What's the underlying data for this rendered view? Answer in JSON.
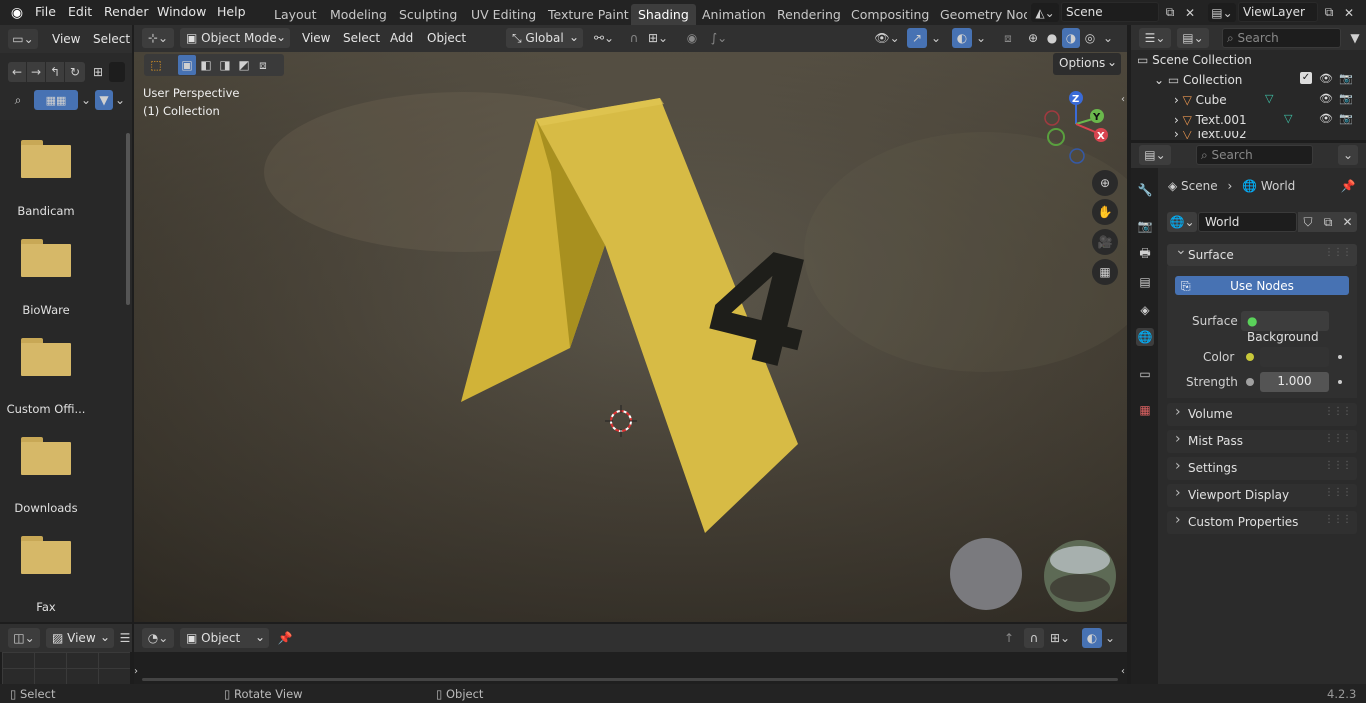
{
  "menu": [
    "File",
    "Edit",
    "Render",
    "Window",
    "Help"
  ],
  "workspaces": [
    "Layout",
    "Modeling",
    "Sculpting",
    "UV Editing",
    "Texture Paint",
    "Shading",
    "Animation",
    "Rendering",
    "Compositing",
    "Geometry Node"
  ],
  "active_workspace": "Shading",
  "scene_name": "Scene",
  "view_layer": "ViewLayer",
  "file_browser": {
    "header": [
      "View",
      "Select"
    ],
    "folders": [
      "Bandicam",
      "BioWare",
      "Custom Offi...",
      "Downloads",
      "Fax"
    ]
  },
  "viewport": {
    "mode": "Object Mode",
    "menus": [
      "View",
      "Select",
      "Add",
      "Object"
    ],
    "transform": "Global",
    "options_label": "Options",
    "overlay_text1": "User Perspective",
    "overlay_text2": "(1) Collection",
    "marker_number": "4",
    "gizmo": {
      "x": "X",
      "y": "Y",
      "z": "Z"
    }
  },
  "shader_editor": {
    "mode": "Object"
  },
  "outliner": {
    "search_placeholder": "Search",
    "root": "Scene Collection",
    "collection": "Collection",
    "items": [
      "Cube",
      "Text.001",
      "Text.002"
    ]
  },
  "properties": {
    "search_placeholder": "Search",
    "breadcrumb": [
      "Scene",
      "World"
    ],
    "world_name": "World",
    "surface_section": "Surface",
    "use_nodes_label": "Use Nodes",
    "surface_label": "Surface",
    "surface_value": "Background",
    "color_label": "Color",
    "strength_label": "Strength",
    "strength_value": "1.000",
    "collapsed_sections": [
      "Volume",
      "Mist Pass",
      "Settings",
      "Viewport Display",
      "Custom Properties"
    ]
  },
  "timeline": {
    "view_label": "View"
  },
  "statusbar": {
    "select": "Select",
    "rotate": "Rotate View",
    "object": "Object",
    "version": "4.2.3"
  },
  "colors": {
    "accent": "#4772b3",
    "marker_yellow": "#d4b53a",
    "active_tab": "#3d3d3d"
  }
}
